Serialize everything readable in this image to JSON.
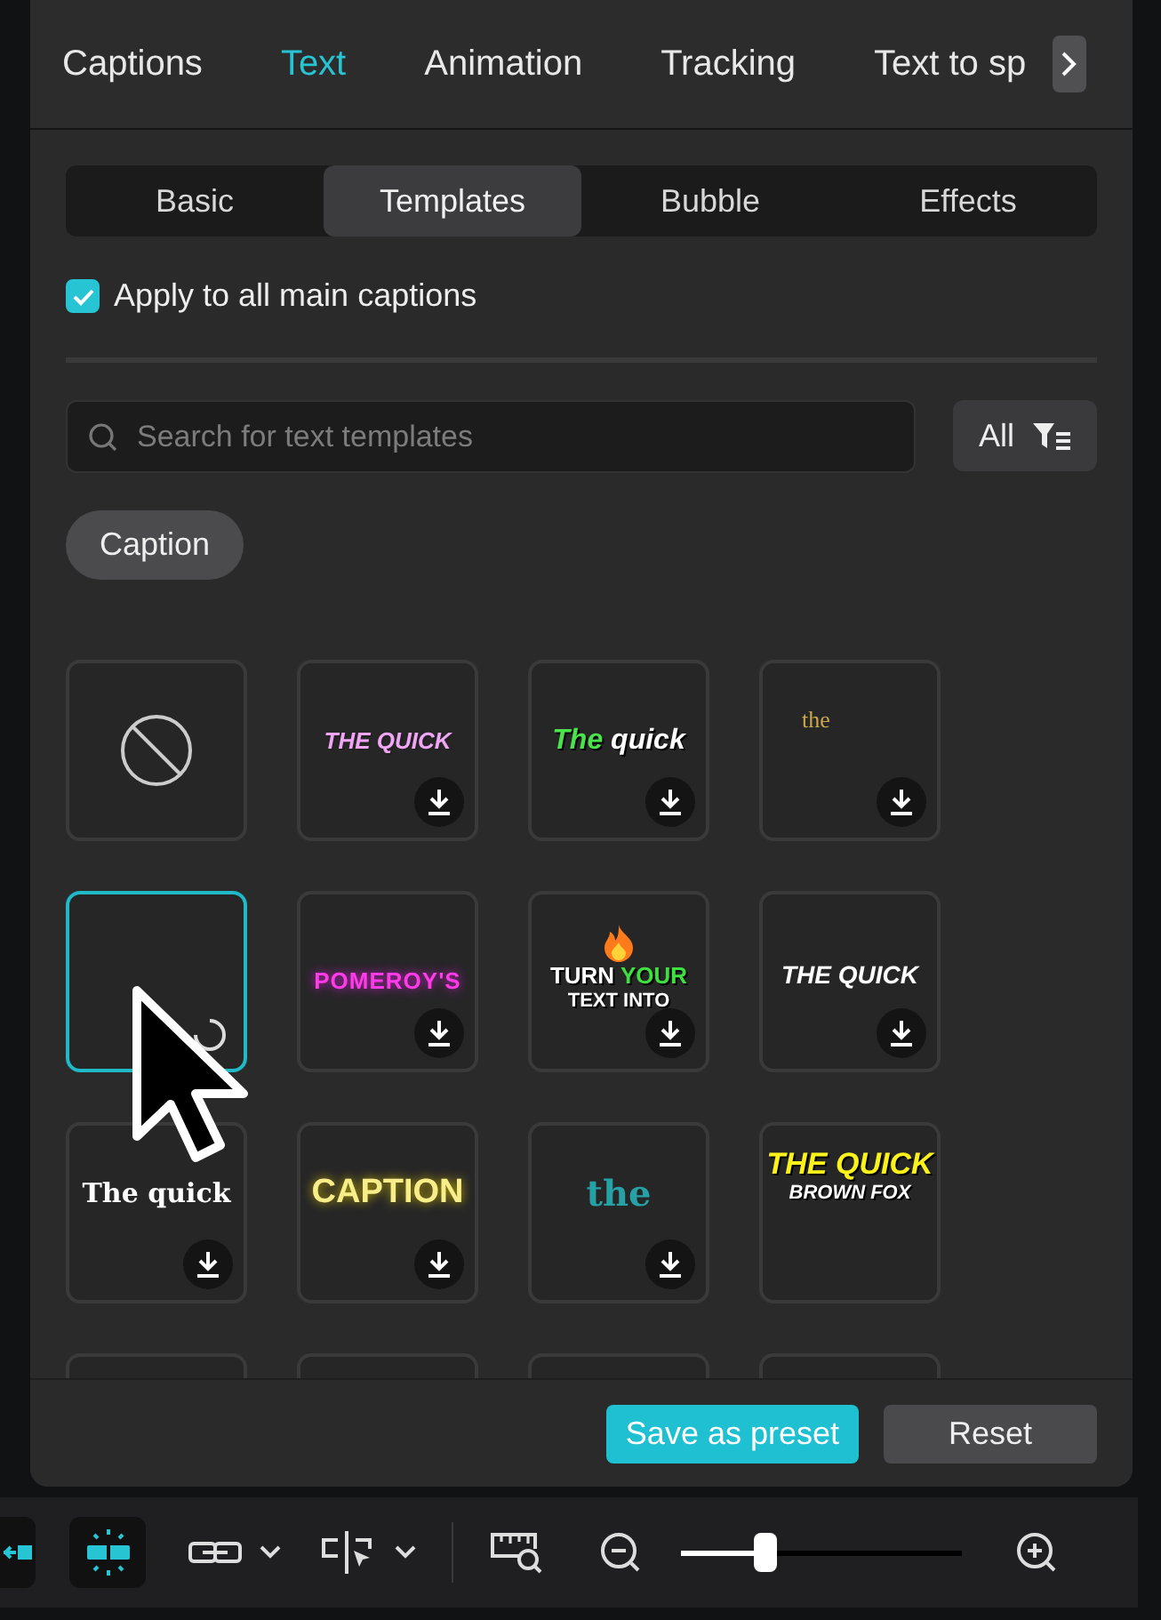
{
  "tabs": [
    {
      "label": "Captions",
      "selected": false
    },
    {
      "label": "Text",
      "selected": true
    },
    {
      "label": "Animation",
      "selected": false
    },
    {
      "label": "Tracking",
      "selected": false
    },
    {
      "label": "Text to sp",
      "selected": false
    }
  ],
  "subtabs": [
    {
      "label": "Basic",
      "selected": false
    },
    {
      "label": "Templates",
      "selected": true
    },
    {
      "label": "Bubble",
      "selected": false
    },
    {
      "label": "Effects",
      "selected": false
    }
  ],
  "apply_all": {
    "label": "Apply to all main captions",
    "checked": true
  },
  "search": {
    "placeholder": "Search for text templates"
  },
  "filter": {
    "label": "All"
  },
  "category": {
    "label": "Caption"
  },
  "tiles": [
    {
      "kind": "none"
    },
    {
      "kind": "pinkitalic",
      "downloadable": true,
      "lines": [
        [
          {
            "text": "THE QUICK"
          }
        ]
      ]
    },
    {
      "kind": "greenwhite",
      "downloadable": true,
      "lines": [
        [
          {
            "text": "The",
            "color": "#4be34b"
          },
          {
            "text": " quick",
            "color": "#ffffff"
          }
        ]
      ]
    },
    {
      "kind": "goldserif",
      "downloadable": true,
      "lines": [
        [
          {
            "text": "the"
          }
        ]
      ]
    },
    {
      "kind": "loading",
      "selected": true
    },
    {
      "kind": "magentaglow",
      "downloadable": true,
      "lines": [
        [
          {
            "text": "POMEROY'S"
          }
        ]
      ]
    },
    {
      "kind": "firebold",
      "downloadable": true,
      "lines": [
        [
          {
            "text": "TURN ",
            "color": "#ffffff"
          },
          {
            "text": "YOUR",
            "color": "#3ee03e"
          }
        ],
        [
          {
            "text": "TEXT INTO",
            "color": "#ffffff"
          }
        ]
      ]
    },
    {
      "kind": "whiteitalic",
      "downloadable": true,
      "lines": [
        [
          {
            "text": "THE QUICK"
          }
        ]
      ]
    },
    {
      "kind": "whiteserif",
      "downloadable": true,
      "lines": [
        [
          {
            "text": "The quick"
          }
        ]
      ]
    },
    {
      "kind": "yellowglow",
      "downloadable": true,
      "lines": [
        [
          {
            "text": "CAPTION"
          }
        ]
      ]
    },
    {
      "kind": "tealserif",
      "downloadable": true,
      "lines": [
        [
          {
            "text": "the"
          }
        ]
      ]
    },
    {
      "kind": "yellowcomic",
      "downloadable": false,
      "lines": [
        [
          {
            "text": "THE QUICK"
          }
        ],
        [
          {
            "text": "BROWN FOX"
          }
        ]
      ]
    },
    {
      "kind": "blank"
    },
    {
      "kind": "blank"
    },
    {
      "kind": "blank"
    },
    {
      "kind": "blank"
    }
  ],
  "footer": {
    "save": "Save as preset",
    "reset": "Reset"
  },
  "toolbar": {
    "zoom": {
      "level": 0.3
    }
  }
}
